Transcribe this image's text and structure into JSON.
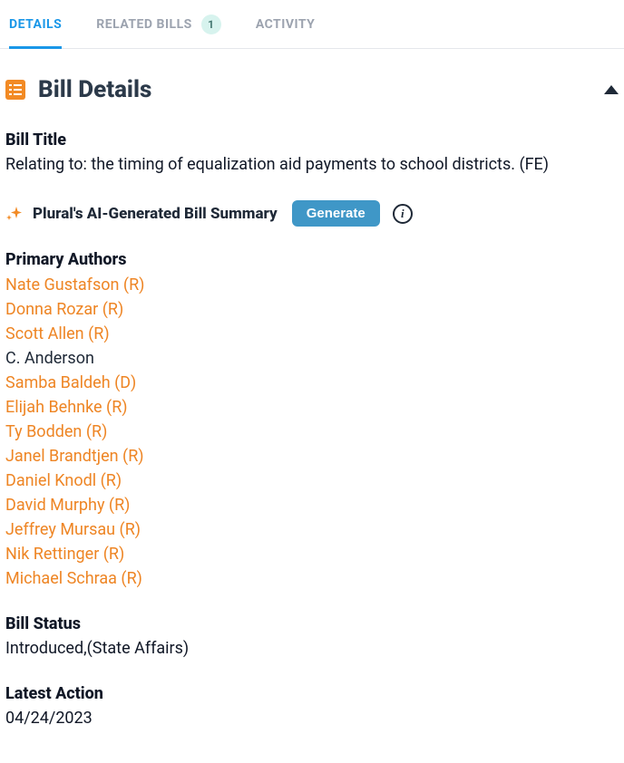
{
  "tabs": {
    "details": "DETAILS",
    "related": "RELATED BILLS",
    "related_count": "1",
    "activity": "ACTIVITY"
  },
  "section_title": "Bill Details",
  "bill_title_label": "Bill Title",
  "bill_title_value": "Relating to: the timing of equalization aid payments to school districts. (FE)",
  "summary_label": "Plural's AI-Generated Bill Summary",
  "generate_label": "Generate",
  "authors_label": "Primary Authors",
  "authors": [
    {
      "name": "Nate Gustafson (R)",
      "link": true
    },
    {
      "name": "Donna Rozar (R)",
      "link": true
    },
    {
      "name": "Scott Allen (R)",
      "link": true
    },
    {
      "name": "C. Anderson",
      "link": false
    },
    {
      "name": "Samba Baldeh (D)",
      "link": true
    },
    {
      "name": "Elijah Behnke (R)",
      "link": true
    },
    {
      "name": "Ty Bodden (R)",
      "link": true
    },
    {
      "name": "Janel Brandtjen (R)",
      "link": true
    },
    {
      "name": "Daniel Knodl (R)",
      "link": true
    },
    {
      "name": "David Murphy (R)",
      "link": true
    },
    {
      "name": "Jeffrey Mursau (R)",
      "link": true
    },
    {
      "name": "Nik Rettinger (R)",
      "link": true
    },
    {
      "name": "Michael Schraa (R)",
      "link": true
    }
  ],
  "status_label": "Bill Status",
  "status_value": "Introduced,(State Affairs)",
  "latest_action_label": "Latest Action",
  "latest_action_value": "04/24/2023"
}
